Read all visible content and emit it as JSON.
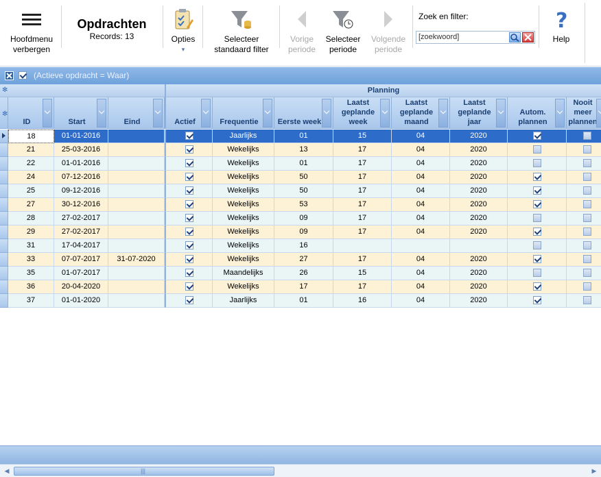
{
  "ribbon": {
    "hide_menu": "Hoofdmenu verbergen",
    "title": "Opdrachten",
    "records": "Records: 13",
    "options": "Opties",
    "select_filter": "Selecteer standaard filter",
    "prev_period": "Vorige periode",
    "select_period": "Selecteer periode",
    "next_period": "Volgende periode",
    "search_label": "Zoek en filter:",
    "search_value": "[zoekwoord]",
    "help": "Help"
  },
  "filterbar": {
    "text": "(Actieve opdracht = Waar)"
  },
  "grid": {
    "group_planning": "Planning",
    "columns": [
      "ID",
      "Start",
      "Eind",
      "Actief",
      "Frequentie",
      "Eerste week",
      "Laatst geplande week",
      "Laatst geplande maand",
      "Laatst geplande jaar",
      "Autom. plannen",
      "Nooit meer plannen"
    ],
    "rows": [
      [
        "18",
        "01-01-2016",
        "",
        true,
        "Jaarlijks",
        "01",
        "15",
        "04",
        "2020",
        true,
        false
      ],
      [
        "21",
        "25-03-2016",
        "",
        true,
        "Wekelijks",
        "13",
        "17",
        "04",
        "2020",
        false,
        false
      ],
      [
        "22",
        "01-01-2016",
        "",
        true,
        "Wekelijks",
        "01",
        "17",
        "04",
        "2020",
        false,
        false
      ],
      [
        "24",
        "07-12-2016",
        "",
        true,
        "Wekelijks",
        "50",
        "17",
        "04",
        "2020",
        true,
        false
      ],
      [
        "25",
        "09-12-2016",
        "",
        true,
        "Wekelijks",
        "50",
        "17",
        "04",
        "2020",
        true,
        false
      ],
      [
        "27",
        "30-12-2016",
        "",
        true,
        "Wekelijks",
        "53",
        "17",
        "04",
        "2020",
        true,
        false
      ],
      [
        "28",
        "27-02-2017",
        "",
        true,
        "Wekelijks",
        "09",
        "17",
        "04",
        "2020",
        false,
        false
      ],
      [
        "29",
        "27-02-2017",
        "",
        true,
        "Wekelijks",
        "09",
        "17",
        "04",
        "2020",
        true,
        false
      ],
      [
        "31",
        "17-04-2017",
        "",
        true,
        "Wekelijks",
        "16",
        "",
        "",
        "",
        false,
        false
      ],
      [
        "33",
        "07-07-2017",
        "31-07-2020",
        true,
        "Wekelijks",
        "27",
        "17",
        "04",
        "2020",
        true,
        false
      ],
      [
        "35",
        "01-07-2017",
        "",
        true,
        "Maandelijks",
        "26",
        "15",
        "04",
        "2020",
        false,
        false
      ],
      [
        "36",
        "20-04-2020",
        "",
        true,
        "Wekelijks",
        "17",
        "17",
        "04",
        "2020",
        true,
        false
      ],
      [
        "37",
        "01-01-2020",
        "",
        true,
        "Jaarlijks",
        "01",
        "16",
        "04",
        "2020",
        true,
        false
      ]
    ]
  }
}
